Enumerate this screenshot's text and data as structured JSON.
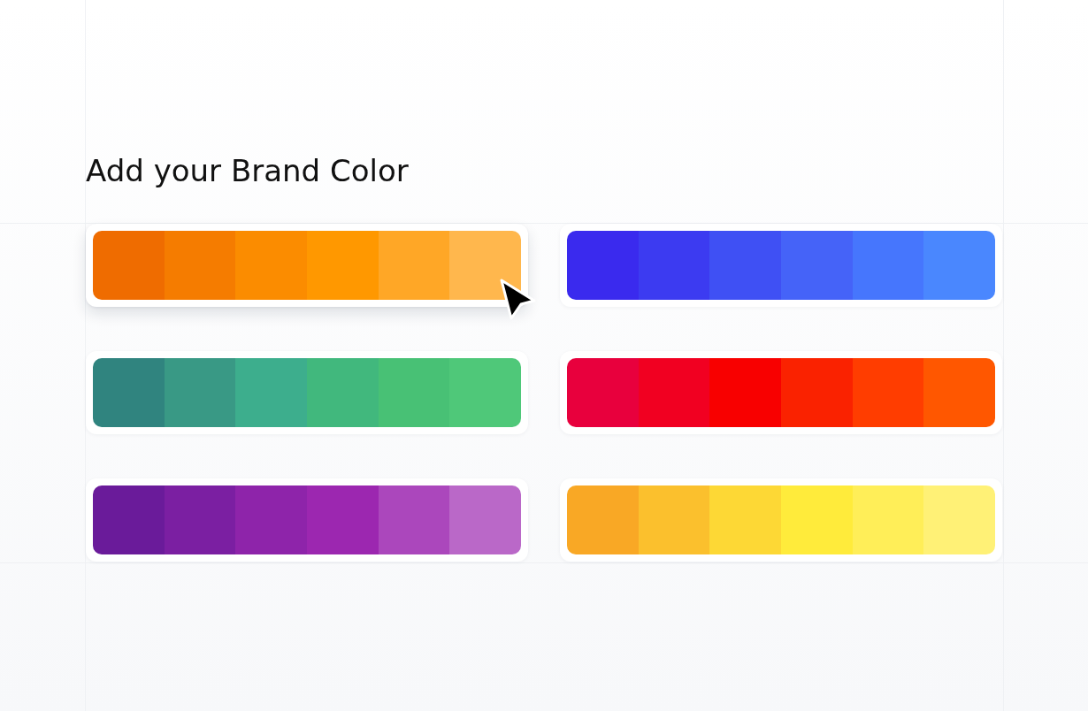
{
  "heading": "Add your Brand Color",
  "palettes": [
    {
      "selected": true,
      "swatches": [
        {
          "color": "#ef6c00"
        },
        {
          "color": "#f57c00"
        },
        {
          "color": "#fb8c00"
        },
        {
          "color": "#ff9800"
        },
        {
          "color": "#ffa726"
        },
        {
          "color": "#ffb74d"
        }
      ]
    },
    {
      "selected": false,
      "swatches": [
        {
          "color": "#3a2aee"
        },
        {
          "color": "#3c3bf1"
        },
        {
          "color": "#3f50f4"
        },
        {
          "color": "#4563f8"
        },
        {
          "color": "#4676fd"
        },
        {
          "color": "#4a87fe"
        }
      ]
    },
    {
      "selected": false,
      "swatches": [
        {
          "color": "#30847f"
        },
        {
          "color": "#399985"
        },
        {
          "color": "#3dae8d"
        },
        {
          "color": "#41b87d"
        },
        {
          "color": "#48c175"
        },
        {
          "color": "#4fc879"
        }
      ]
    },
    {
      "selected": false,
      "swatches": [
        {
          "color": "#e8003d"
        },
        {
          "color": "#f10021"
        },
        {
          "color": "#f80000"
        },
        {
          "color": "#fa2200"
        },
        {
          "color": "#ff3d00"
        },
        {
          "color": "#ff5700"
        }
      ]
    },
    {
      "selected": false,
      "swatches": [
        {
          "color": "#6a1b9a"
        },
        {
          "color": "#7b1fa2"
        },
        {
          "color": "#8e24aa"
        },
        {
          "color": "#9c27b0"
        },
        {
          "color": "#ab47bc"
        },
        {
          "color": "#ba68c8"
        }
      ]
    },
    {
      "selected": false,
      "swatches": [
        {
          "color": "#f9a825"
        },
        {
          "color": "#fbc02d"
        },
        {
          "color": "#fdd835"
        },
        {
          "color": "#ffeb3b"
        },
        {
          "color": "#ffee58"
        },
        {
          "color": "#fff176"
        }
      ]
    }
  ]
}
